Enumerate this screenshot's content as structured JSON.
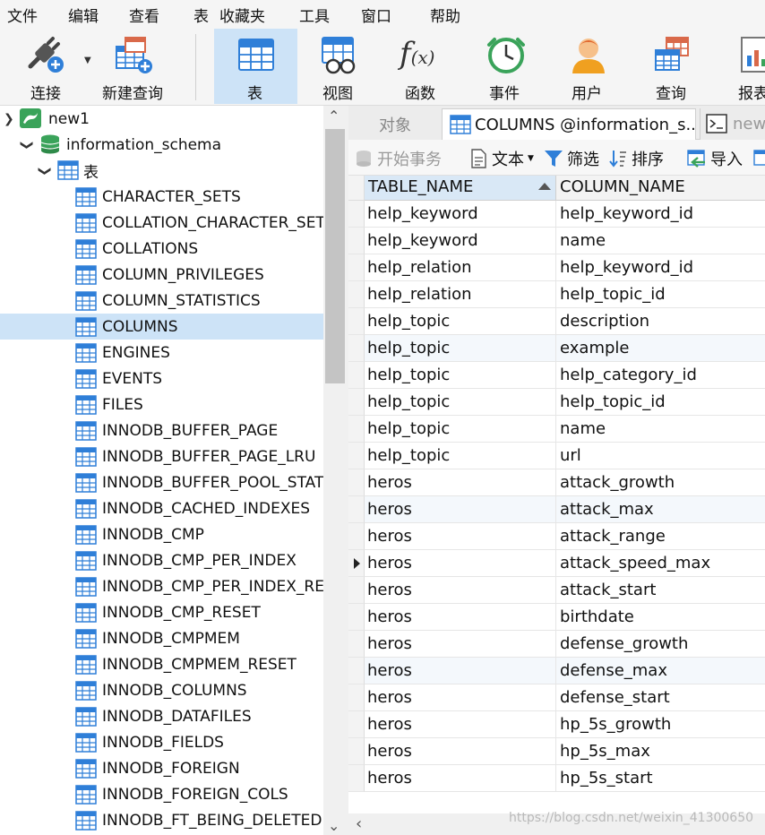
{
  "menu": [
    "文件",
    "编辑",
    "查看",
    "表",
    "收藏夹",
    "工具",
    "窗口",
    "帮助"
  ],
  "toolbar": {
    "connect": "连接",
    "new_query": "新建查询",
    "table": "表",
    "view": "视图",
    "function": "函数",
    "event": "事件",
    "user": "用户",
    "query": "查询",
    "report": "报表"
  },
  "tree": {
    "connection": "new1",
    "database": "information_schema",
    "tables_group": "表",
    "items": [
      "CHARACTER_SETS",
      "COLLATION_CHARACTER_SET_APPLICABILITY",
      "COLLATIONS",
      "COLUMN_PRIVILEGES",
      "COLUMN_STATISTICS",
      "COLUMNS",
      "ENGINES",
      "EVENTS",
      "FILES",
      "INNODB_BUFFER_PAGE",
      "INNODB_BUFFER_PAGE_LRU",
      "INNODB_BUFFER_POOL_STATS",
      "INNODB_CACHED_INDEXES",
      "INNODB_CMP",
      "INNODB_CMP_PER_INDEX",
      "INNODB_CMP_PER_INDEX_RESET",
      "INNODB_CMP_RESET",
      "INNODB_CMPMEM",
      "INNODB_CMPMEM_RESET",
      "INNODB_COLUMNS",
      "INNODB_DATAFILES",
      "INNODB_FIELDS",
      "INNODB_FOREIGN",
      "INNODB_FOREIGN_COLS",
      "INNODB_FT_BEING_DELETED"
    ],
    "selected": "COLUMNS"
  },
  "tabs": {
    "objects": "对象",
    "columns": "COLUMNS @information_s...",
    "new_query": "new"
  },
  "subtoolbar": {
    "begin_tx": "开始事务",
    "text": "文本",
    "filter": "筛选",
    "sort": "排序",
    "import": "导入"
  },
  "grid": {
    "headers": [
      "TABLE_NAME",
      "COLUMN_NAME"
    ],
    "rows": [
      [
        "help_keyword",
        "help_keyword_id"
      ],
      [
        "help_keyword",
        "name"
      ],
      [
        "help_relation",
        "help_keyword_id"
      ],
      [
        "help_relation",
        "help_topic_id"
      ],
      [
        "help_topic",
        "description"
      ],
      [
        "help_topic",
        "example"
      ],
      [
        "help_topic",
        "help_category_id"
      ],
      [
        "help_topic",
        "help_topic_id"
      ],
      [
        "help_topic",
        "name"
      ],
      [
        "help_topic",
        "url"
      ],
      [
        "heros",
        "attack_growth"
      ],
      [
        "heros",
        "attack_max"
      ],
      [
        "heros",
        "attack_range"
      ],
      [
        "heros",
        "attack_speed_max"
      ],
      [
        "heros",
        "attack_start"
      ],
      [
        "heros",
        "birthdate"
      ],
      [
        "heros",
        "defense_growth"
      ],
      [
        "heros",
        "defense_max"
      ],
      [
        "heros",
        "defense_start"
      ],
      [
        "heros",
        "hp_5s_growth"
      ],
      [
        "heros",
        "hp_5s_max"
      ],
      [
        "heros",
        "hp_5s_start"
      ]
    ]
  },
  "watermark": "https://blog.csdn.net/weixin_41300650"
}
